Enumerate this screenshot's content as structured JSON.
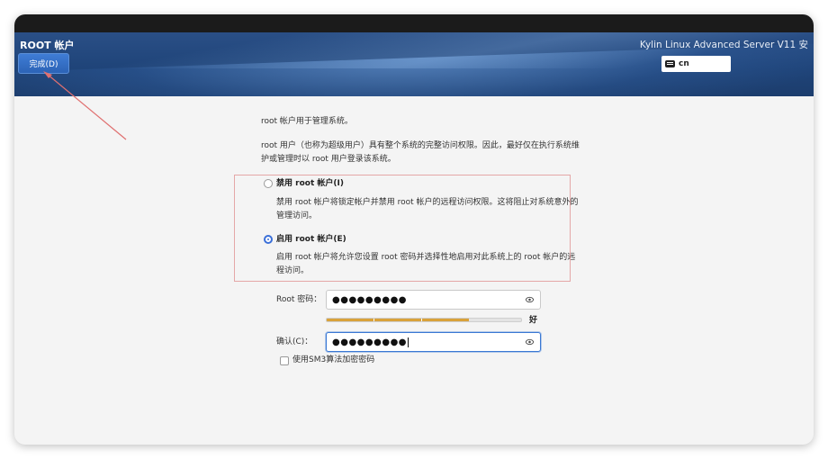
{
  "header": {
    "title": "ROOT 帐户",
    "done_button": "完成(D)",
    "product": "Kylin Linux Advanced Server V11 安",
    "keyboard_layout": "cn"
  },
  "main": {
    "intro": "root 帐户用于管理系统。",
    "desc_line1": "root 用户（也称为超级用户）具有整个系统的完整访问权限。因此，最好仅在执行系统维",
    "desc_line2": "护或管理时以 root 用户登录该系统。",
    "disable_option": {
      "label": "禁用 root 帐户(I)",
      "desc_line1": "禁用 root 帐户将锁定帐户并禁用 root 帐户的远程访问权限。这将阻止对系统意外的",
      "desc_line2": "管理访问。",
      "selected": false
    },
    "enable_option": {
      "label": "启用 root 帐户(E)",
      "desc_line1": "启用 root 帐户将允许您设置 root 密码并选择性地启用对此系统上的 root 帐户的远",
      "desc_line2": "程访问。",
      "selected": true
    },
    "password": {
      "label": "Root 密码：",
      "value": "●●●●●●●●●",
      "strength_label": "好",
      "strength_fraction": 0.73
    },
    "confirm": {
      "label": "确认(C)：",
      "value": "●●●●●●●●●"
    },
    "sm3_checkbox": {
      "label": "使用SM3算法加密密码",
      "checked": false
    }
  },
  "colors": {
    "accent": "#3a6fd8",
    "header_bg": "#1f4479",
    "strength": "#d9a23a",
    "annotation": "#e07070"
  }
}
